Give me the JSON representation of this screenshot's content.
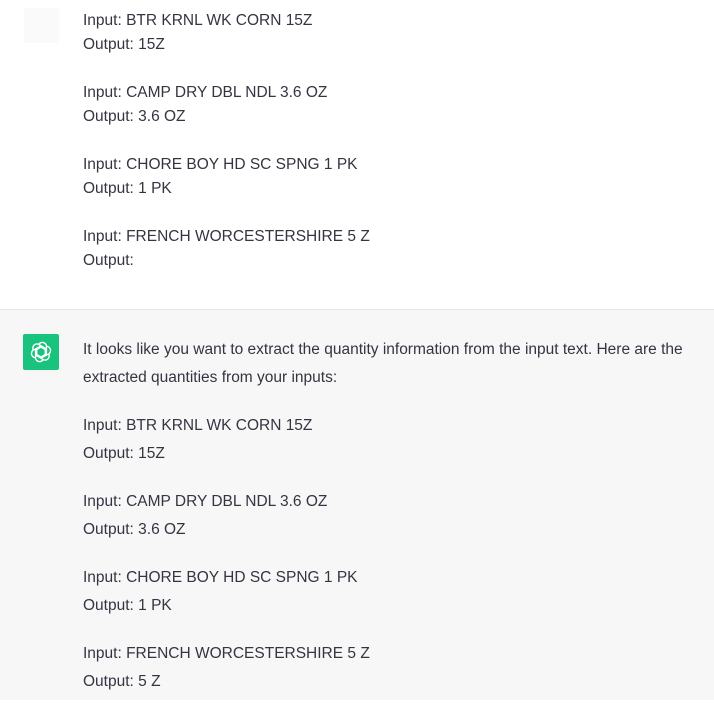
{
  "user_message": {
    "pairs": [
      {
        "input": "Input: BTR KRNL WK CORN 15Z",
        "output": "Output: 15Z"
      },
      {
        "input": "Input: CAMP DRY DBL NDL 3.6 OZ",
        "output": "Output: 3.6 OZ"
      },
      {
        "input": "Input: CHORE BOY HD SC SPNG 1 PK",
        "output": "Output: 1 PK"
      },
      {
        "input": "Input: FRENCH WORCESTERSHIRE 5 Z",
        "output": "Output:"
      }
    ]
  },
  "assistant_message": {
    "intro": "It looks like you want to extract the quantity information from the input text. Here are the extracted quantities from your inputs:",
    "pairs": [
      {
        "input": "Input: BTR KRNL WK CORN 15Z",
        "output": "Output: 15Z"
      },
      {
        "input": "Input: CAMP DRY DBL NDL 3.6 OZ",
        "output": "Output: 3.6 OZ"
      },
      {
        "input": "Input: CHORE BOY HD SC SPNG 1 PK",
        "output": "Output: 1 PK"
      },
      {
        "input": "Input: FRENCH WORCESTERSHIRE 5 Z",
        "output": "Output: 5 Z"
      }
    ]
  },
  "colors": {
    "assistant_avatar": "#19c37d",
    "assistant_background": "#f7f7f8",
    "text": "#343541"
  },
  "icons": {
    "assistant_avatar": "openai-logo-icon",
    "user_avatar": "user-avatar"
  }
}
